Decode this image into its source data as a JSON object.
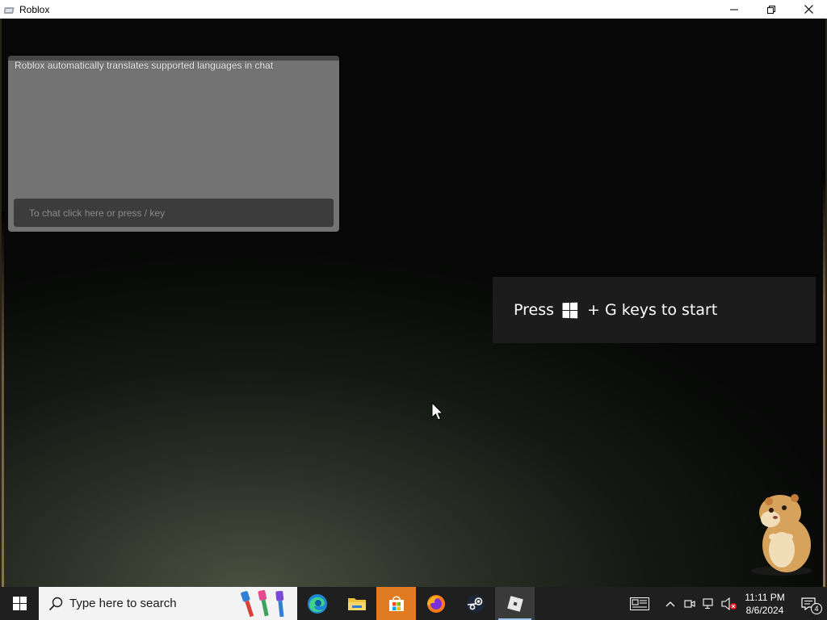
{
  "window": {
    "title": "Roblox",
    "icon": "roblox-window-icon",
    "controls": [
      "minimize-icon",
      "restore-icon",
      "close-icon"
    ]
  },
  "chat": {
    "system_message": "Roblox automatically translates supported languages in chat",
    "input_placeholder": "To chat click here or press / key"
  },
  "game_bar_toast": {
    "prefix": "Press",
    "icon": "windows-key-icon",
    "suffix": "+ G keys to start"
  },
  "taskbar": {
    "start_icon": "windows-start-icon",
    "search_placeholder": "Type here to search",
    "apps": [
      {
        "name": "Microsoft Edge",
        "icon": "edge-icon"
      },
      {
        "name": "File Explorer",
        "icon": "folder-icon"
      },
      {
        "name": "Microsoft Store",
        "icon": "store-icon"
      },
      {
        "name": "Firefox",
        "icon": "firefox-icon"
      },
      {
        "name": "Steam",
        "icon": "steam-icon"
      },
      {
        "name": "Roblox",
        "icon": "roblox-icon"
      }
    ],
    "clock": {
      "time": "11:11 PM",
      "date": "8/6/2024"
    },
    "notification_count": "4"
  },
  "colors": {
    "taskbar_bg": "#1f1f1f",
    "store_highlight": "#e07a23",
    "toast_bg": "#1c1c1c"
  }
}
